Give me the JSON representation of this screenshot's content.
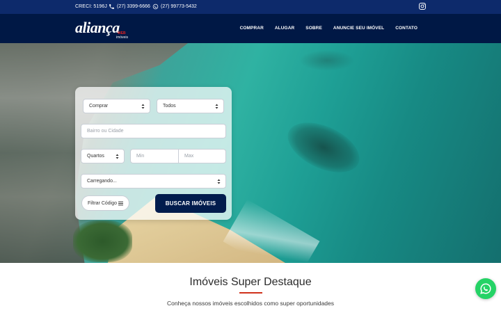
{
  "topbar": {
    "creci": "CRECI: 5196J",
    "phone": "(27) 3399-6666",
    "whatsapp": "(27) 99773-5432",
    "instagram_icon": "instagram-icon"
  },
  "header": {
    "logo_text": "aliança",
    "logo_sub_web": "WEB",
    "logo_sub_imoveis": "imóveis",
    "nav": [
      "COMPRAR",
      "ALUGAR",
      "SOBRE",
      "ANUNCIE SEU IMÓVEL",
      "CONTATO"
    ]
  },
  "search": {
    "transaction": "Comprar",
    "type": "Todos",
    "location_placeholder": "Bairro ou Cidade",
    "rooms": "Quartos",
    "min_placeholder": "Min",
    "max_placeholder": "Max",
    "loading": "Carregando...",
    "filter_label": "Filtrar Código",
    "search_label": "BUSCAR IMÓVEIS"
  },
  "featured": {
    "title": "Imóveis Super Destaque",
    "subtitle": "Conheça nossos imóveis escolhidos como super oportunidades"
  },
  "colors": {
    "topbar": "#0d2a6b",
    "header": "#001845",
    "button": "#011c4d",
    "accent_line": "#d0311b",
    "whatsapp": "#25d366"
  }
}
